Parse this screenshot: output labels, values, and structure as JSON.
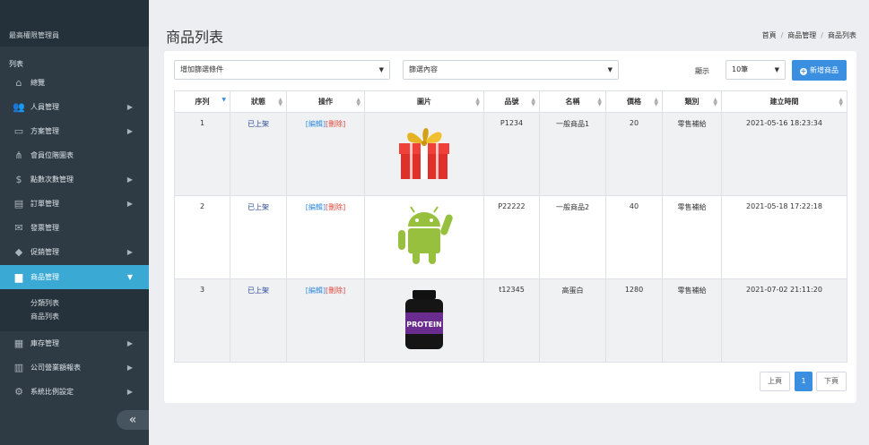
{
  "sidebar": {
    "header": "最高權限管理員",
    "section": "列表",
    "items": [
      {
        "label": "總覽",
        "icon": "home-icon"
      },
      {
        "label": "人員管理",
        "icon": "users-icon"
      },
      {
        "label": "方案管理",
        "icon": "id-card-icon"
      },
      {
        "label": "會員位階圖表",
        "icon": "sitemap-icon"
      },
      {
        "label": "點數次數管理",
        "icon": "dollar-icon"
      },
      {
        "label": "訂單管理",
        "icon": "document-icon"
      },
      {
        "label": "發票管理",
        "icon": "envelope-icon"
      },
      {
        "label": "促銷管理",
        "icon": "tag-icon"
      },
      {
        "label": "商品管理",
        "icon": "shopping-bag-icon"
      },
      {
        "label": "庫存管理",
        "icon": "barcode-icon"
      },
      {
        "label": "公司營業額報表",
        "icon": "bar-chart-icon"
      },
      {
        "label": "系統比例設定",
        "icon": "gear-icon"
      }
    ],
    "sub_items": [
      "分類列表",
      "商品列表"
    ],
    "collapse_glyph": "«"
  },
  "main": {
    "title": "商品列表",
    "breadcrumb": [
      "首頁",
      "商品管理",
      "商品列表"
    ],
    "breadcrumb_sep": "/"
  },
  "filters": {
    "condition": "增加篩選條件",
    "content": "篩選內容",
    "show_label": "顯示",
    "page_size": "10筆",
    "add_button": "新增商品"
  },
  "table": {
    "headers": [
      "序列",
      "狀態",
      "操作",
      "圖片",
      "品號",
      "名稱",
      "價格",
      "類別",
      "建立時間"
    ],
    "rows": [
      {
        "seq": "1",
        "status": "已上架",
        "edit": "[編輯]",
        "delete": "[刪除]",
        "image": "gift-icon",
        "sku": "P1234",
        "name": "一般商品1",
        "price": "20",
        "category": "零售補給",
        "created": "2021-05-16 18:23:34"
      },
      {
        "seq": "2",
        "status": "已上架",
        "edit": "[編輯]",
        "delete": "[刪除]",
        "image": "android-icon",
        "sku": "P22222",
        "name": "一般商品2",
        "price": "40",
        "category": "零售補給",
        "created": "2021-05-18 17:22:18"
      },
      {
        "seq": "3",
        "status": "已上架",
        "edit": "[編輯]",
        "delete": "[刪除]",
        "image": "protein-jar-icon",
        "image_text": "PROTEIN",
        "sku": "t12345",
        "name": "高蛋白",
        "price": "1280",
        "category": "零售補給",
        "created": "2021-07-02 21:11:20"
      }
    ]
  },
  "pagination": {
    "prev": "上頁",
    "current": "1",
    "next": "下頁"
  },
  "colors": {
    "sidebar": "#2e3b45",
    "active": "#3aa9d4",
    "primary": "#3a8fe0",
    "delete": "#e0453a",
    "status": "#2c4a9a"
  }
}
